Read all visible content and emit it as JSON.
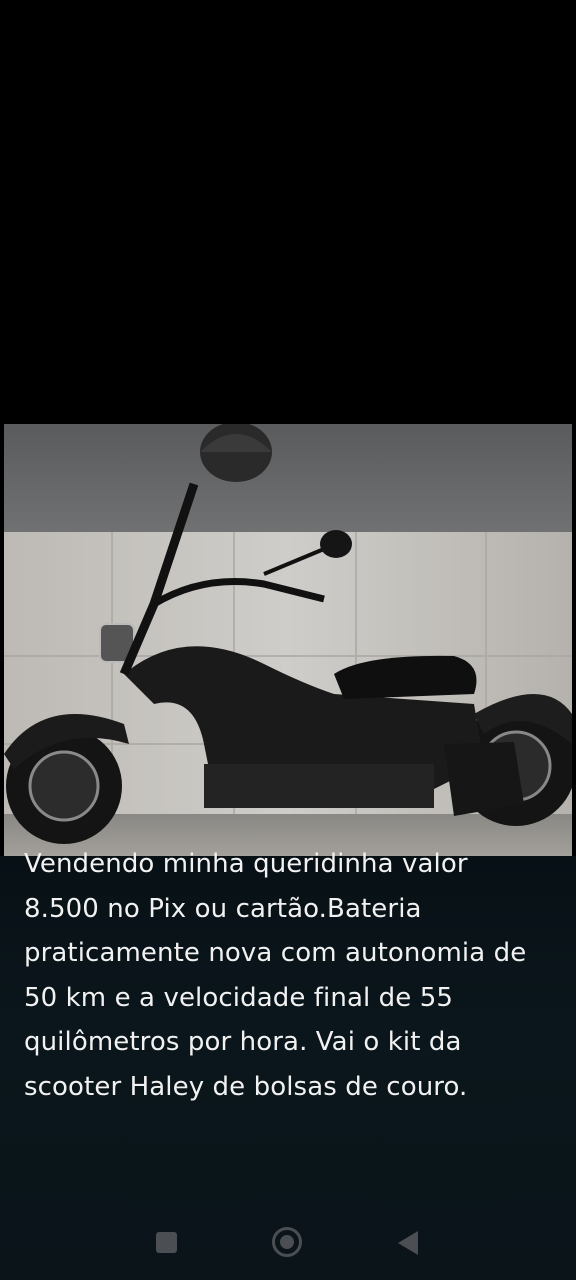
{
  "post": {
    "photo_alt": "Scooter elétrica estilo chopper preta",
    "caption": "Vendendo minha queridinha valor\n8.500 no Pix ou cartão.Bateria\npraticamente nova com autonomia de\n50 km e a velocidade final de 55\nquilômetros por hora. Vai o kit da\nscooter Haley de bolsas de couro."
  },
  "navigation": {
    "recents_icon": "square-icon",
    "home_icon": "circle-icon",
    "back_icon": "triangle-left-icon"
  }
}
